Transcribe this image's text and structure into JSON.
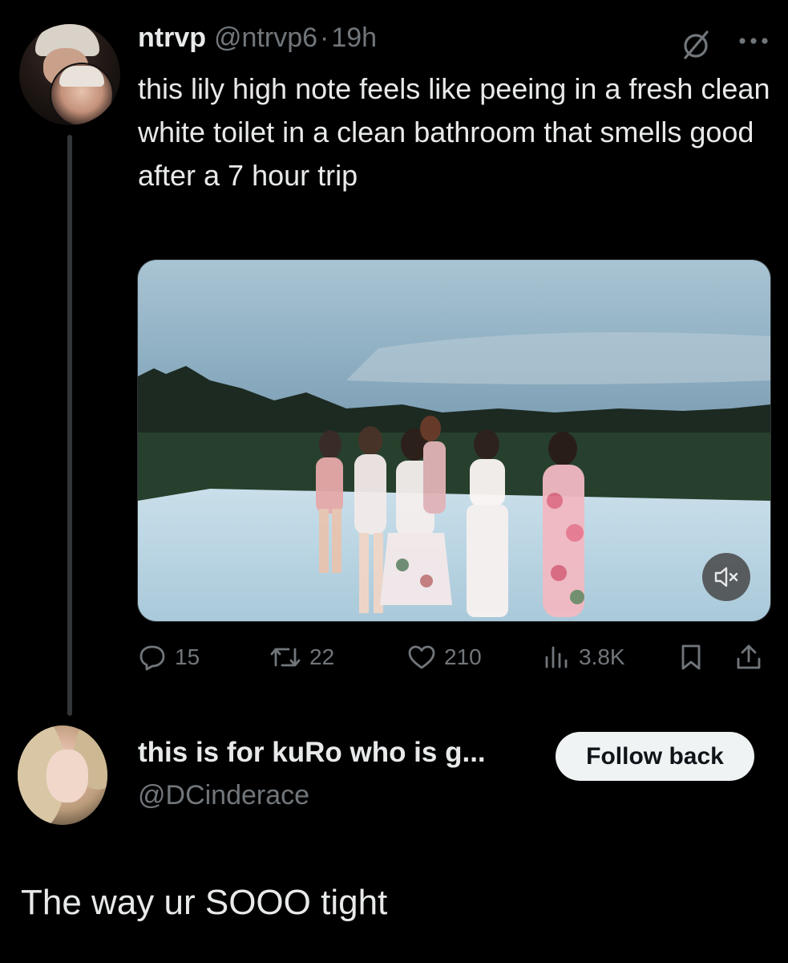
{
  "tweet": {
    "display_name": "ntrvp",
    "handle": "@ntrvp6",
    "separator": "·",
    "time": "19h",
    "text": "this lily high note feels like peeing in a fresh clean white toilet in a clean bathroom that smells good after a 7 hour trip",
    "media": {
      "type": "video",
      "muted": true
    },
    "stats": {
      "replies": "15",
      "reposts": "22",
      "likes": "210",
      "views": "3.8K"
    }
  },
  "reply_author": {
    "display_name": "this is for kuRo who is g...",
    "handle": "@DCinderace",
    "follow_label": "Follow back"
  },
  "reply_text": "The way ur SOOO tight",
  "colors": {
    "background": "#000000",
    "primary_text": "#e7e9ea",
    "secondary_text": "#71767b",
    "button_bg": "#eff3f4",
    "button_text": "#0f1419",
    "thread_line": "#333639"
  },
  "icons": {
    "grok": "grok-slash-icon",
    "more": "more-dots-icon",
    "reply": "reply-bubble-icon",
    "repost": "repost-arrows-icon",
    "like": "heart-icon",
    "views": "views-bars-icon",
    "bookmark": "bookmark-icon",
    "share": "share-upload-icon",
    "mute": "speaker-muted-icon"
  }
}
